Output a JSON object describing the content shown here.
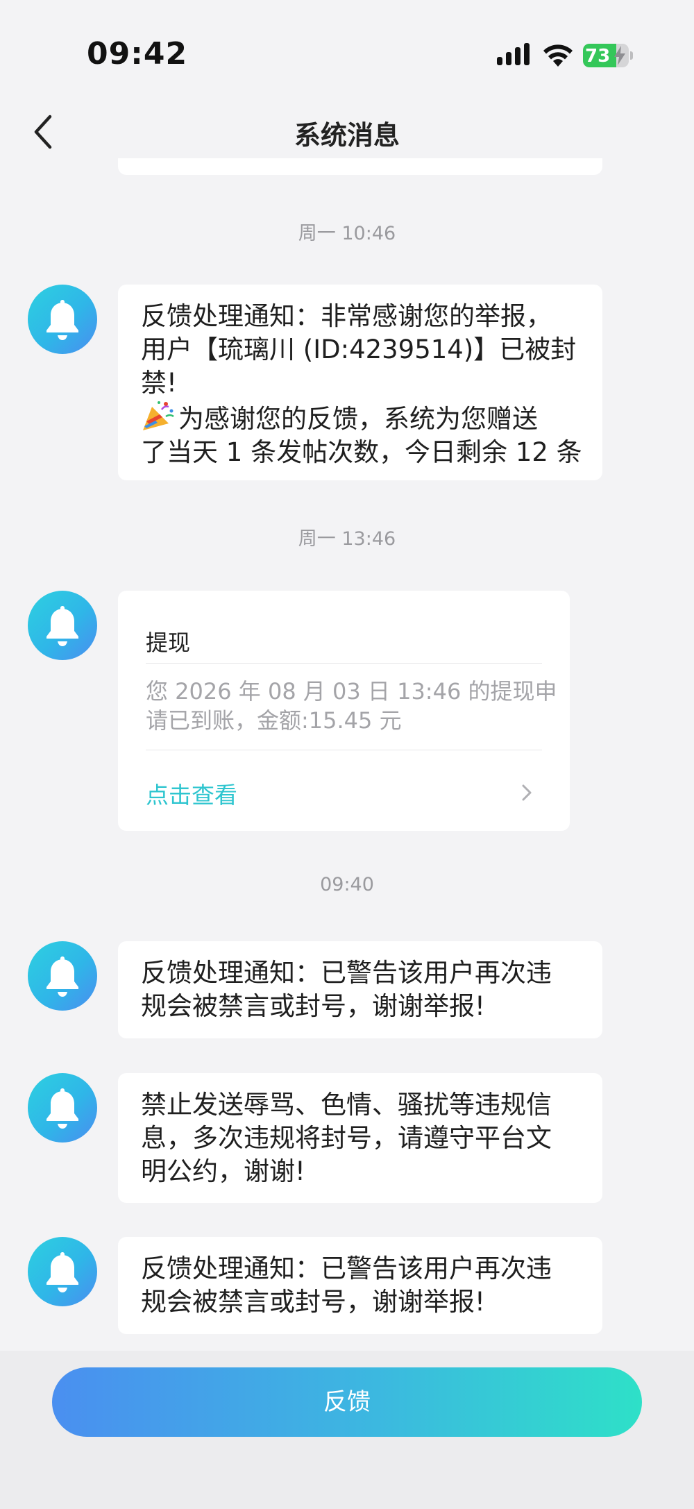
{
  "status_bar": {
    "time": "09:42",
    "battery_percent": "73",
    "battery_level": 0.73,
    "icons": [
      "signal-icon",
      "wifi-icon",
      "battery-icon",
      "charging-bolt-icon"
    ]
  },
  "header": {
    "title": "系统消息",
    "back_icon": "chevron-left-icon"
  },
  "messages": [
    {
      "timestamp": "周一 10:46",
      "avatar_icon": "bell-icon",
      "lines": [
        "反馈处理通知：非常感谢您的举报，",
        "用户【琉璃川 (ID:4239514)】已被封",
        "禁!",
        "为感谢您的反馈，系统为您赠送",
        "了当天 1 条发帖次数，今日剩余 12 条"
      ],
      "emoji_icon": "party-popper-icon"
    },
    {
      "timestamp": "周一 13:46",
      "avatar_icon": "bell-icon",
      "card": {
        "title": "提现",
        "body_lines": [
          "您 2026 年 08 月 03 日 13:46 的提现申",
          "请已到账，金额:15.45 元"
        ],
        "link_label": "点击查看",
        "link_icon": "chevron-right-icon"
      }
    },
    {
      "timestamp": "09:40",
      "avatar_icon": "bell-icon",
      "lines": [
        "反馈处理通知：已警告该用户再次违",
        "规会被禁言或封号，谢谢举报!"
      ]
    },
    {
      "avatar_icon": "bell-icon",
      "lines": [
        "禁止发送辱骂、色情、骚扰等违规信",
        "息，多次违规将封号，请遵守平台文",
        "明公约，谢谢!"
      ]
    },
    {
      "avatar_icon": "bell-icon",
      "lines": [
        "反馈处理通知：已警告该用户再次违",
        "规会被禁言或封号，谢谢举报!"
      ]
    }
  ],
  "bottom": {
    "feedback_label": "反馈"
  },
  "colors": {
    "background": "#f3f3f5",
    "accent": "#2ec5cf",
    "avatar_gradient": [
      "#2ed0e0",
      "#4a8df0"
    ],
    "button_gradient": [
      "#4a8ff0",
      "#2ee0c8"
    ],
    "battery_green": "#34c759"
  }
}
